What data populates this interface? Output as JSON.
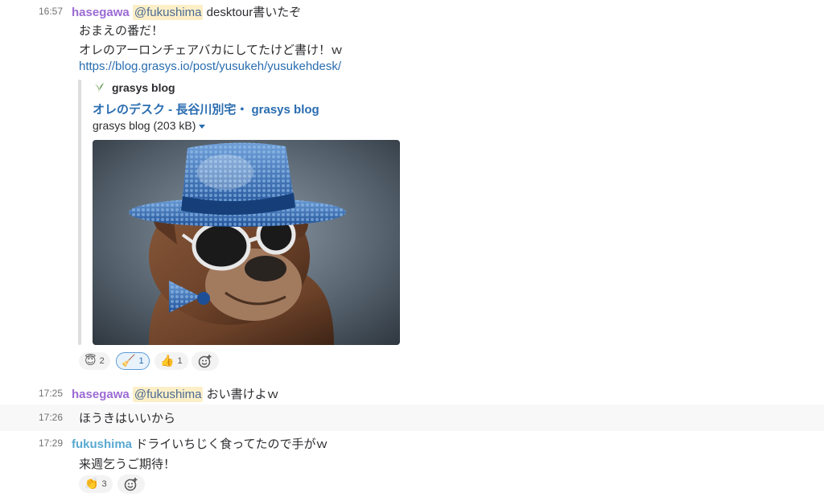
{
  "messages": [
    {
      "time": "16:57",
      "user": "hasegawa",
      "mention": "@fukushima",
      "text": "desktour書いたぞ",
      "lines": [
        "おまえの番だ！",
        "オレのアーロンチェアバカにしてたけど書け！ｗ"
      ],
      "link": "https://blog.grasys.io/post/yusukeh/yusukehdesk/",
      "attachment": {
        "service_name": "grasys blog",
        "title": "オレのデスク - 長谷川別宅・ grasys blog",
        "meta": "grasys blog (203 kB)"
      },
      "reactions": [
        {
          "emoji": "😇",
          "count": "2",
          "active": false
        },
        {
          "emoji": "🧹",
          "count": "1",
          "active": true
        },
        {
          "emoji": "👍",
          "count": "1",
          "active": false
        }
      ]
    },
    {
      "time": "17:25",
      "user": "hasegawa",
      "mention": "@fukushima",
      "text": "おい書けよｗ"
    },
    {
      "time": "17:26",
      "text": "ほうきはいいから"
    },
    {
      "time": "17:29",
      "user": "fukushima",
      "text": "ドライいちじく食ってたので手がｗ",
      "lines": [
        "来週乞うご期待！"
      ],
      "reactions": [
        {
          "emoji": "👏",
          "count": "3",
          "active": false
        }
      ]
    }
  ],
  "colors": {
    "hasegawa": "#9b6bd4",
    "fukushima": "#5aa9d2",
    "link": "#2a6db0",
    "mention_bg": "#fcefc7",
    "hover_bg": "#f8f8f8"
  },
  "icons": {
    "service_logo": "leaf-icon",
    "add_reaction": "add-reaction-icon",
    "caret": "caret-down-icon"
  }
}
